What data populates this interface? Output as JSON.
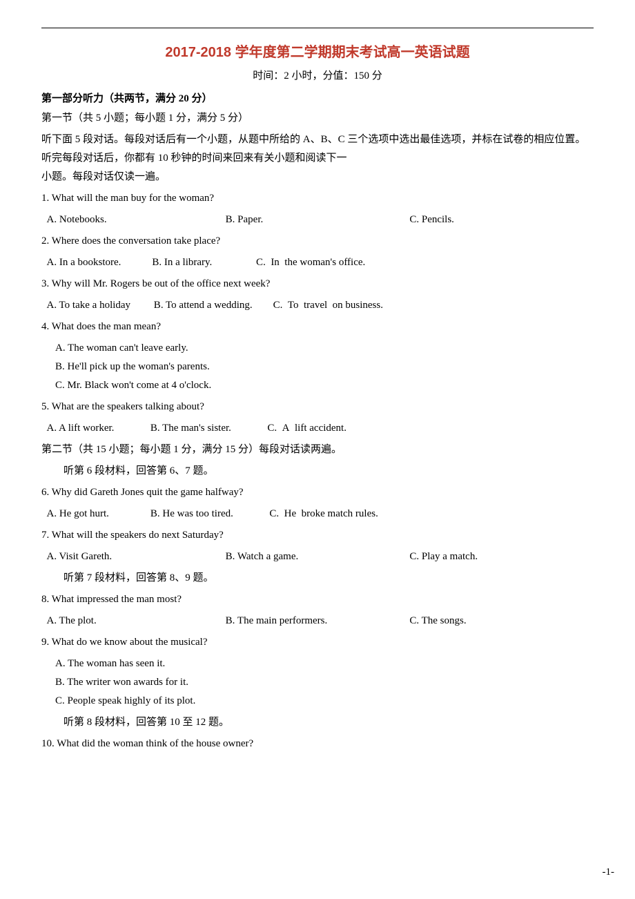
{
  "title": "2017-2018 学年度第二学期期末考试高一英语试题",
  "subtitle": "时间：2 小时，分值：150 分",
  "section1_title": "第一部分听力（共两节，满分 20 分）",
  "section1_sub1": "第一节（共 5 小题；每小题 1 分，满分 5 分）",
  "section1_desc": "听下面 5 段对话。每段对话后有一个小题，从题中所给的 A、B、C 三个选项中选出最佳选项，并标在试卷的相应位置。听完每段对话后，你都有 10 秒钟的时间来回来有关小题和阅读下一小题。每段对话仅读一遍。",
  "questions": [
    {
      "num": "1.",
      "text": "What will the man buy for the woman?",
      "options": [
        "A. Notebooks.",
        "B. Paper.",
        "C. Pencils."
      ]
    },
    {
      "num": "2.",
      "text": "Where does the conversation take place?",
      "options": [
        "A. In a bookstore.",
        "B. In a library.",
        "C.  In  the woman's office."
      ]
    },
    {
      "num": "3.",
      "text": "Why will Mr. Rogers be out of the office next week?",
      "options": [
        "A. To take a holiday",
        "B. To attend a wedding.",
        "C.  To  travel  on business."
      ]
    },
    {
      "num": "4.",
      "text": "What does the man mean?",
      "options_block": [
        "A. The woman can't leave early.",
        "B. He'll pick up the woman's parents.",
        "C. Mr. Black won't come at 4 o'clock."
      ]
    },
    {
      "num": "5.",
      "text": "What are the speakers talking about?",
      "options": [
        "A. A lift worker.",
        "B. The man's sister.",
        "C.  A  lift accident."
      ]
    }
  ],
  "section2_title": "第二节（共 15 小题；每小题 1 分，满分 15 分）每段对话读两遍。",
  "listen6_7": "听第 6 段材料，回答第 6、7 题。",
  "q6": {
    "num": "6.",
    "text": "Why did Gareth Jones quit the game halfway?",
    "options": [
      "A. He got hurt.",
      "B. He was too tired.",
      "C.  He  broke match rules."
    ]
  },
  "q7": {
    "num": "7.",
    "text": "What will the speakers do next Saturday?",
    "options": [
      "A. Visit Gareth.",
      "B. Watch a game.",
      "C. Play a match."
    ]
  },
  "listen7_8": "听第 7 段材料，回答第 8、9 题。",
  "q8": {
    "num": "8.",
    "text": "What impressed the man most?",
    "options": [
      "A. The plot.",
      "B. The main performers.",
      "C. The songs."
    ]
  },
  "q9": {
    "num": "9.",
    "text": "What do we know about the musical?",
    "options_block": [
      "A. The woman has seen it.",
      "B. The writer won awards for it.",
      "C. People speak highly of its plot."
    ]
  },
  "listen8_10": "听第 8 段材料，回答第 10 至 12 题。",
  "q10": {
    "num": "10.",
    "text": "What did the woman think of the house owner?"
  },
  "page_num": "-1-"
}
